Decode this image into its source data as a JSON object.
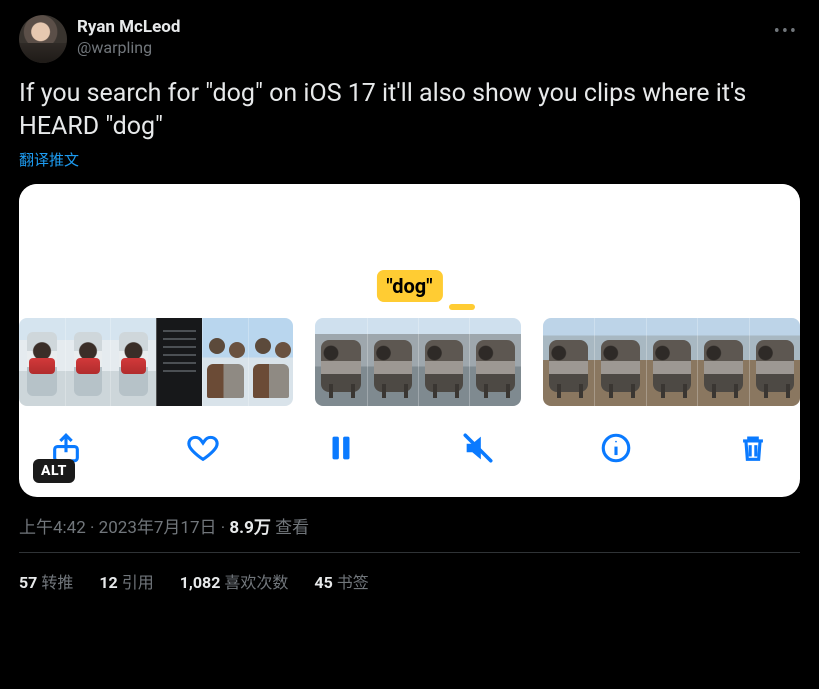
{
  "author": {
    "display_name": "Ryan McLeod",
    "handle": "@warpling"
  },
  "more_icon_label": "•••",
  "body_text": "If you search for \"dog\" on iOS 17 it'll also show you clips where it's HEARD \"dog\"",
  "translate_label": "翻译推文",
  "media": {
    "search_tag": "\"dog\"",
    "alt_badge": "ALT"
  },
  "meta": {
    "time": "上午4:42",
    "separator1": " · ",
    "date": "2023年7月17日",
    "separator2": " · ",
    "views_number": "8.9万",
    "views_label": " 查看"
  },
  "stats": {
    "retweets_num": "57",
    "retweets_label": "转推",
    "quotes_num": "12",
    "quotes_label": "引用",
    "likes_num": "1,082",
    "likes_label": "喜欢次数",
    "bookmarks_num": "45",
    "bookmarks_label": "书签"
  }
}
